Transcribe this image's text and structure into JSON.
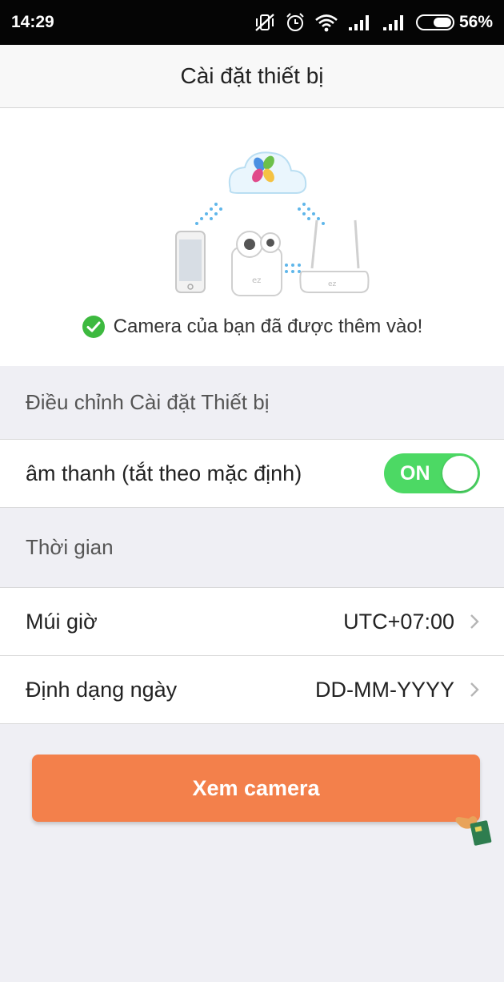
{
  "status_bar": {
    "time": "14:29",
    "battery": "56%",
    "battery_level": 0.56
  },
  "nav": {
    "title": "Cài đặt thiết bị"
  },
  "hero": {
    "success_message": "Camera của bạn đã được thêm vào!"
  },
  "device_section": {
    "header": "Điều chỉnh Cài đặt Thiết bị"
  },
  "sound": {
    "label": "âm thanh (tắt theo mặc định)",
    "toggle_label": "ON"
  },
  "time_section": {
    "header": "Thời gian"
  },
  "timezone": {
    "label": "Múi giờ",
    "value": "UTC+07:00"
  },
  "date_format": {
    "label": "Định dạng ngày",
    "value": "DD-MM-YYYY"
  },
  "primary_button": {
    "label": "Xem camera"
  },
  "colors": {
    "accent": "#f3804b",
    "toggle_on": "#4cd964",
    "success": "#3db93f"
  },
  "icons": [
    "mute-vibrate-icon",
    "alarm-clock-icon",
    "wifi-icon",
    "signal-icon",
    "battery-icon",
    "check-circle-icon",
    "chevron-right-icon",
    "pointing-hand-icon"
  ]
}
